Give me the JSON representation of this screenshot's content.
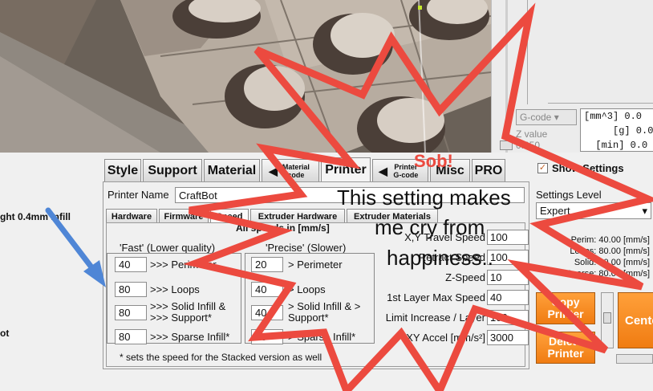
{
  "viewport": {
    "name": "3d-preview"
  },
  "right_top": {
    "code_lines": [
      "[mm^3] 0.0",
      "     [g] 0.0",
      "  [min] 0.0"
    ],
    "gcode_select": "G-code",
    "z_label": "Z value",
    "z_value": "0.250"
  },
  "left_labels": {
    "line1": "ght 0.4mm infill",
    "line2": "ot"
  },
  "tabs": [
    {
      "label": "Style"
    },
    {
      "label": "Support"
    },
    {
      "label": "Material"
    },
    {
      "label": "Material code"
    },
    {
      "label": "Printer"
    },
    {
      "label": "Printer G-code"
    },
    {
      "label": "Misc"
    },
    {
      "label": "PRO"
    }
  ],
  "printer": {
    "name_label": "Printer Name",
    "name_value": "CraftBot"
  },
  "subtabs": [
    {
      "label": "Hardware"
    },
    {
      "label": "Firmware"
    },
    {
      "label": "Speed"
    },
    {
      "label": "Extruder Hardware"
    },
    {
      "label": "Extruder Materials"
    }
  ],
  "speed": {
    "all_speeds": "All speeds in [mm/s]",
    "fast_title": "'Fast' (Lower quality)",
    "precise_title": "'Precise' (Slower)",
    "fast": [
      {
        "value": "40",
        "label": ">>> Perimeter"
      },
      {
        "value": "80",
        "label": ">>> Loops"
      },
      {
        "value": "80",
        "label": ">>> Solid Infill & >>> Support*"
      },
      {
        "value": "80",
        "label": ">>> Sparse Infill*"
      }
    ],
    "precise": [
      {
        "value": "20",
        "label": "> Perimeter"
      },
      {
        "value": "40",
        "label": "> Loops"
      },
      {
        "value": "40",
        "label": "> Solid Infill & > Support*"
      },
      {
        "value": "60",
        "label": "> Sparse Infill*"
      }
    ],
    "right": [
      {
        "label": "X,Y Travel Speed",
        "value": "100"
      },
      {
        "label": "Retract Speed",
        "value": "100"
      },
      {
        "label": "Z-Speed",
        "value": "10"
      },
      {
        "label": "1st Layer Max Speed",
        "value": "40"
      },
      {
        "label": "Limit Increase / Layer",
        "value": "100"
      },
      {
        "label": "XY Accel [mm/s²]",
        "value": "3000"
      }
    ],
    "footnote": "* sets the speed for the Stacked version as well"
  },
  "settings": {
    "show_label": "Show Settings",
    "level_label": "Settings Level",
    "level_value": "Expert",
    "summary": [
      "Perim:  40.00 [mm/s]",
      "Loops:  80.00 [mm/s]",
      "Solid:  80.00 [mm/s]",
      "Sparse:  80.00 [mm/s]"
    ],
    "copy_button": "Copy Printer",
    "delete_button": "Delete Printer",
    "center_button": "Center"
  },
  "overlay": {
    "sob": "Sob!",
    "line1": "This setting makes",
    "line2": "me cry from",
    "line3": "happiness..",
    "colors": {
      "star": "#ec4a3f",
      "arrow": "#4f86d6"
    }
  }
}
